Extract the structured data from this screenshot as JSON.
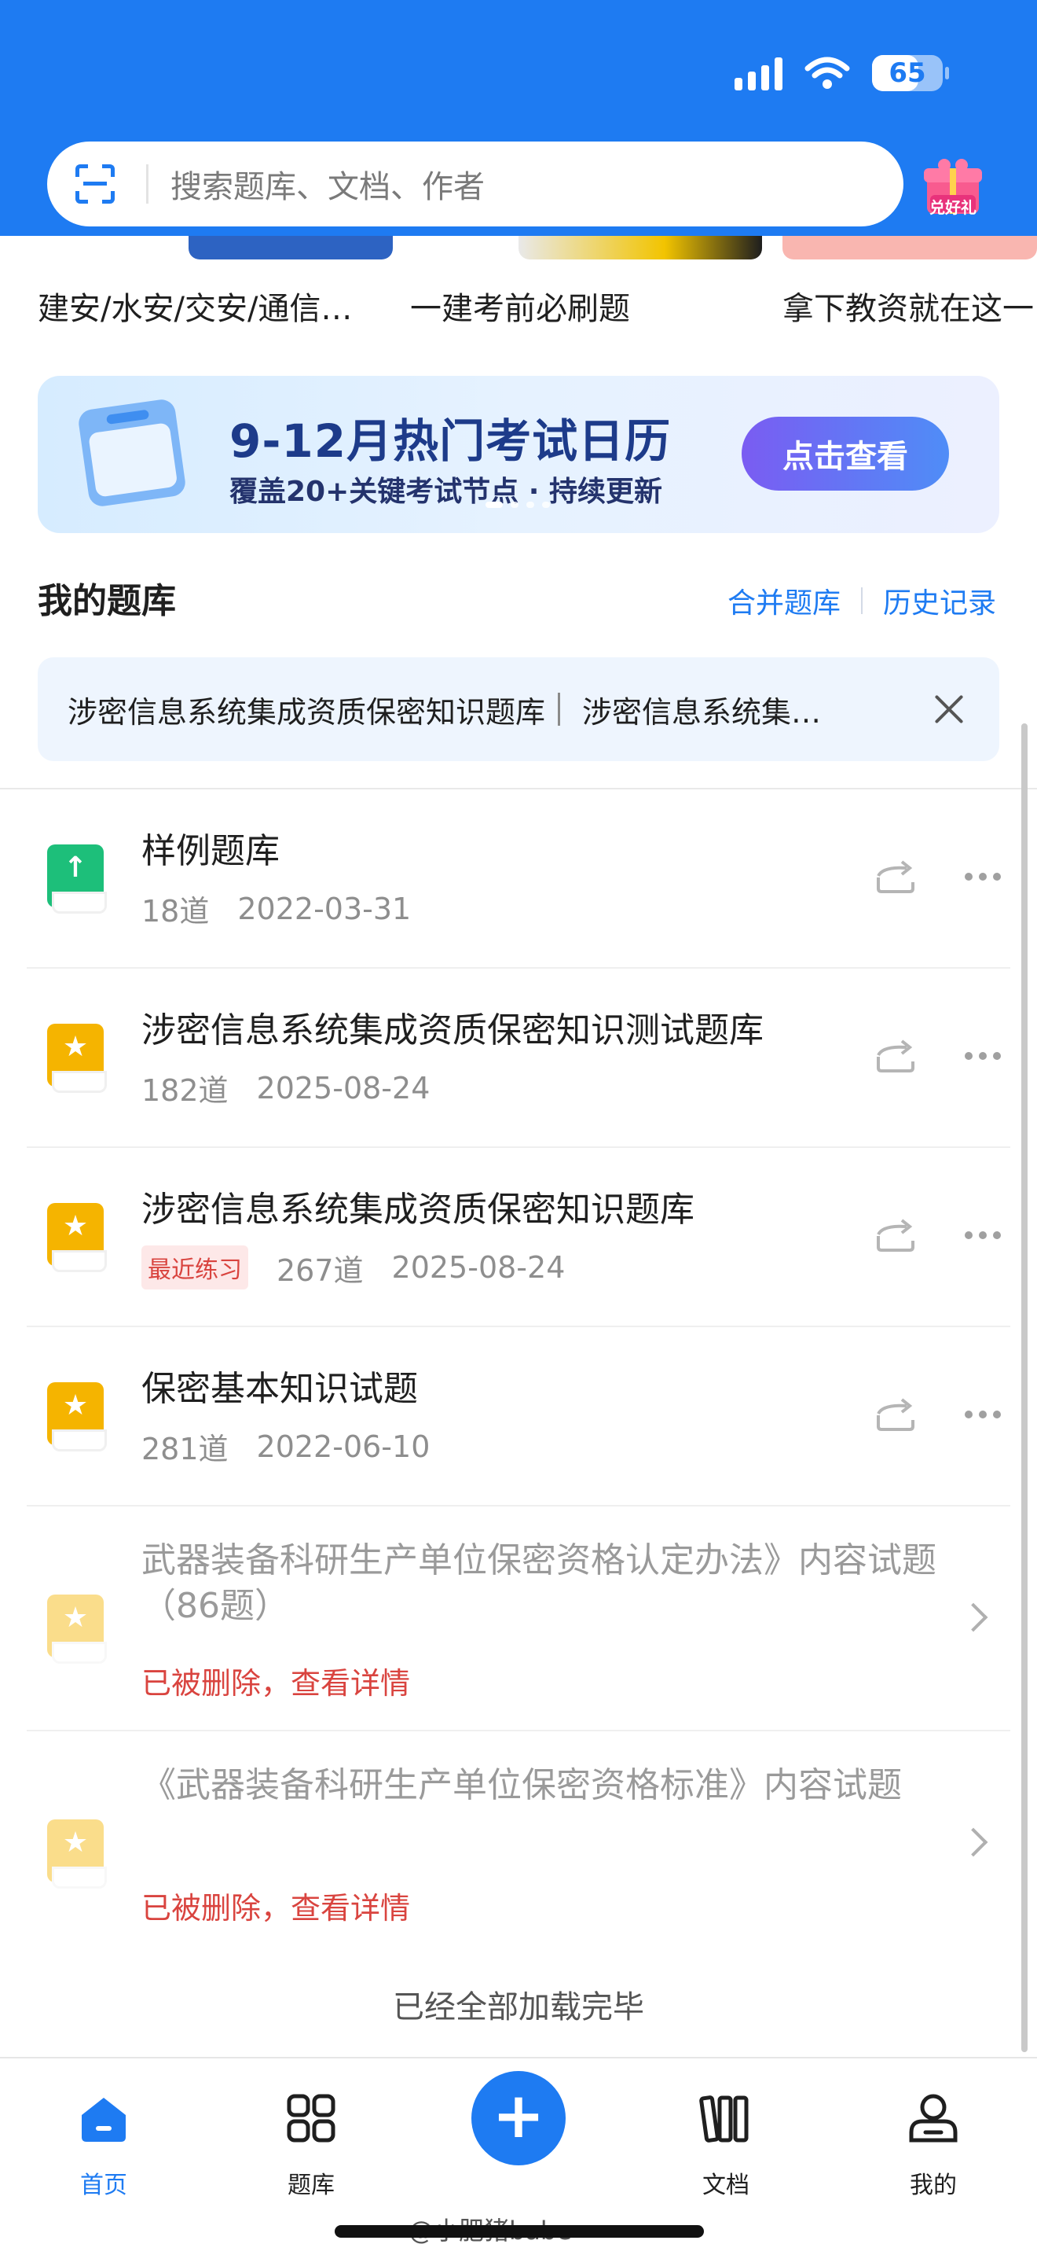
{
  "status_bar": {
    "battery": "65"
  },
  "search": {
    "placeholder": "搜索题库、文档、作者"
  },
  "gift": {
    "label": "兑好礼"
  },
  "categories": [
    {
      "label": "建安/水安/交安/通信…"
    },
    {
      "label": "一建考前必刷题"
    },
    {
      "label": "拿下教资就在这一"
    }
  ],
  "banner": {
    "title": "9-12月热门考试日历",
    "subtitle": "覆盖20+关键考试节点 · 持续更新",
    "button": "点击查看"
  },
  "my_bank": {
    "title": "我的题库",
    "merge": "合并题库",
    "history": "历史记录"
  },
  "recent_bar": {
    "item1": "涉密信息系统集成资质保密知识题库",
    "item2": "涉密信息系统集…"
  },
  "items": [
    {
      "title": "样例题库",
      "count": "18道",
      "date": "2022-03-31",
      "icon": "upload-icon",
      "color": "#1dbf7a"
    },
    {
      "title": "涉密信息系统集成资质保密知识测试题库",
      "count": "182道",
      "date": "2025-08-24",
      "icon": "star-icon",
      "color": "#f5b400"
    },
    {
      "title": "涉密信息系统集成资质保密知识题库",
      "tag": "最近练习",
      "count": "267道",
      "date": "2025-08-24",
      "icon": "star-icon",
      "color": "#f5b400"
    },
    {
      "title": "保密基本知识试题",
      "count": "281道",
      "date": "2022-06-10",
      "icon": "star-icon",
      "color": "#f5b400"
    }
  ],
  "deleted_items": [
    {
      "title": "武器装备科研生产单位保密资格认定办法》内容试题（86题）",
      "status": "已被删除，查看详情"
    },
    {
      "title": "《武器装备科研生产单位保密资格标准》内容试题",
      "status": "已被删除，查看详情"
    }
  ],
  "end_text": "已经全部加载完毕",
  "tabs": [
    {
      "label": "首页",
      "icon": "home-icon"
    },
    {
      "label": "题库",
      "icon": "grid-icon"
    },
    {
      "label": "文档",
      "icon": "documents-icon"
    },
    {
      "label": "我的",
      "icon": "profile-icon"
    }
  ],
  "watermark": "@小肥猪babe",
  "colors": {
    "primary": "#1e7bf2",
    "danger": "#d9443f",
    "star": "#f5b400",
    "green": "#1dbf7a"
  }
}
